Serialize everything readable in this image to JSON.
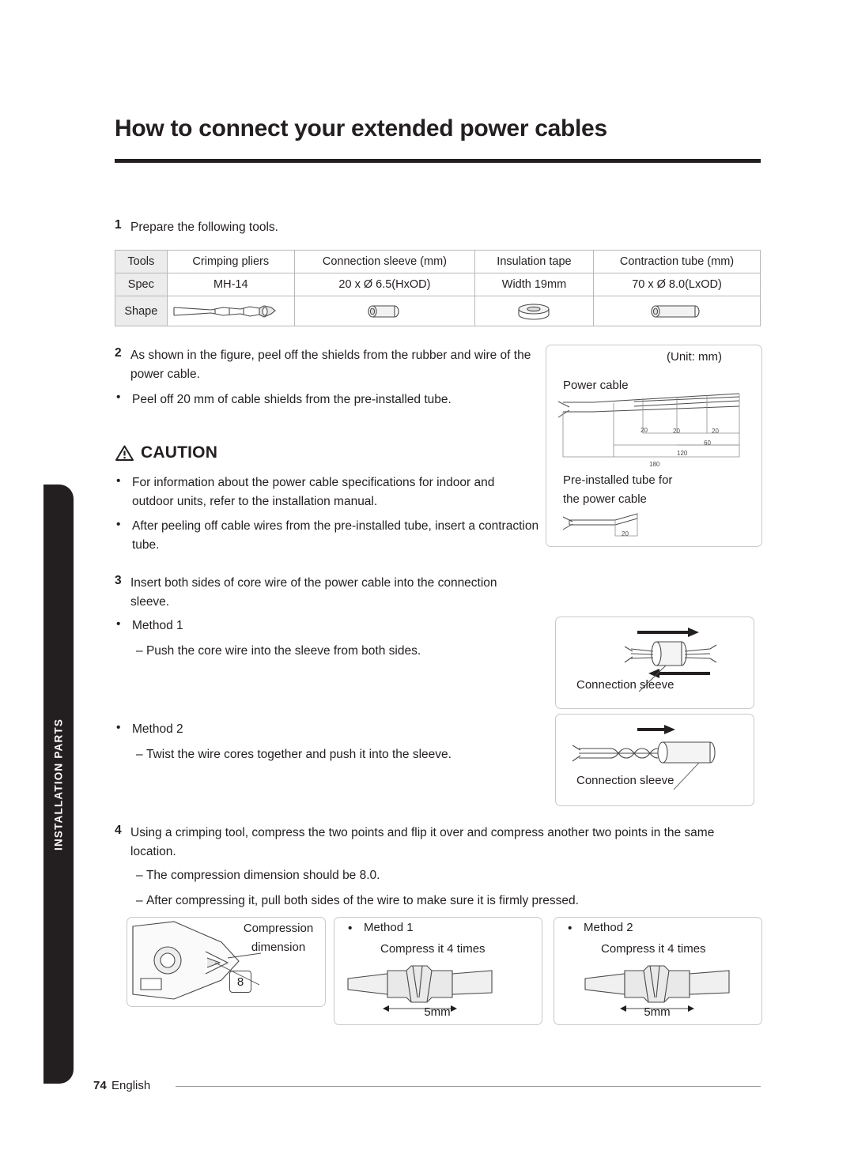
{
  "sidebar": {
    "tab_label": "INSTALLATION PARTS"
  },
  "header": {
    "title": "How to connect your extended power cables"
  },
  "steps": {
    "s1_num": "1",
    "s1_text": "Prepare the following tools.",
    "s2_num": "2",
    "s2_text": "As shown in the figure, peel off the shields from the rubber and wire of the power cable.",
    "s2_bullet": "Peel off 20 mm of cable shields from the pre-installed tube.",
    "s3_num": "3",
    "s3_text": "Insert both sides of core wire of the power cable into the connection sleeve.",
    "s3_m1_label": "Method 1",
    "s3_m1_text": "Push the core wire into the sleeve from both sides.",
    "s3_m2_label": "Method 2",
    "s3_m2_text": "Twist the wire cores together and push it into the sleeve.",
    "s4_num": "4",
    "s4_text": "Using a crimping tool, compress the two points and flip it over and compress another two points in the same location.",
    "s4_dash1": "The compression dimension should be 8.0.",
    "s4_dash2": "After compressing it, pull both sides of the wire to make sure it is firmly pressed."
  },
  "tools_table": {
    "columns": [
      "Tools",
      "Crimping pliers",
      "Connection sleeve (mm)",
      "Insulation tape",
      "Contraction tube (mm)"
    ],
    "rows": [
      {
        "header": "Spec",
        "cells": [
          "MH-14",
          "20 x Ø 6.5(HxOD)",
          "Width 19mm",
          "70 x Ø 8.0(LxOD)"
        ]
      },
      {
        "header": "Shape",
        "cells": [
          "",
          "",
          "",
          ""
        ]
      }
    ]
  },
  "caution": {
    "label": "CAUTION",
    "items": [
      "For information about the power cable specifications for indoor and outdoor units, refer to the installation manual.",
      "After peeling off cable wires from the pre-installed tube, insert a contraction tube."
    ]
  },
  "figures": {
    "unit_note": "(Unit: mm)",
    "power_cable_label": "Power cable",
    "preinstalled_label_line1": "Pre-installed tube for",
    "preinstalled_label_line2": "the power cable",
    "dims": {
      "d20a": "20",
      "d20b": "20",
      "d20c": "20",
      "d60": "60",
      "d120": "120",
      "d180": "180",
      "d20_tube": "20"
    },
    "connection_sleeve_1": "Connection sleeve",
    "connection_sleeve_2": "Connection sleeve",
    "compression_line1": "Compression",
    "compression_line2": "dimension",
    "compression_value": "8",
    "method1_label": "Method 1",
    "method1_text": "Compress it 4 times",
    "method1_dim": "5mm",
    "method2_label": "Method 2",
    "method2_text": "Compress it 4 times",
    "method2_dim": "5mm"
  },
  "footer": {
    "page_number": "74",
    "language": "English"
  }
}
